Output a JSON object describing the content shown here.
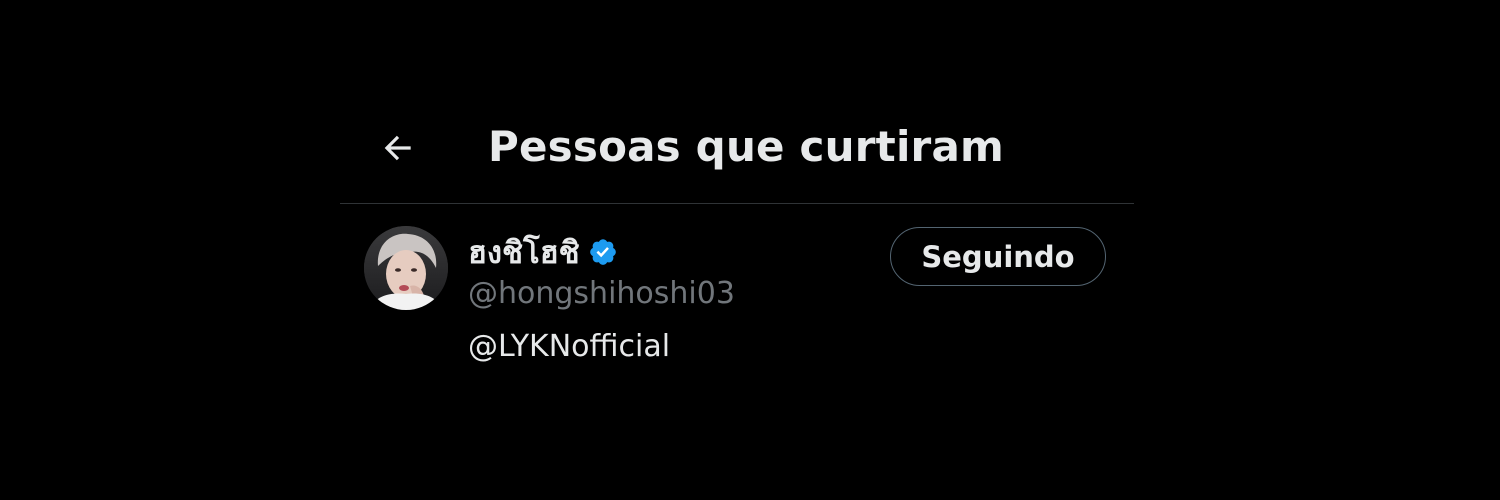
{
  "header": {
    "back_icon": "arrow-left-icon",
    "title": "Pessoas que curtiram"
  },
  "users": [
    {
      "display_name": "ฮงชิโฮชิ",
      "verified": true,
      "verified_icon": "verified-badge-icon",
      "verified_color": "#1d9bf0",
      "handle": "@hongshihoshi03",
      "bio": "@LYKNofficial",
      "follow_label": "Seguindo"
    }
  ],
  "colors": {
    "background": "#000000",
    "primary_text": "#e7e9ea",
    "secondary_text": "#71767b",
    "divider": "#2f3336",
    "button_border": "#536471"
  }
}
